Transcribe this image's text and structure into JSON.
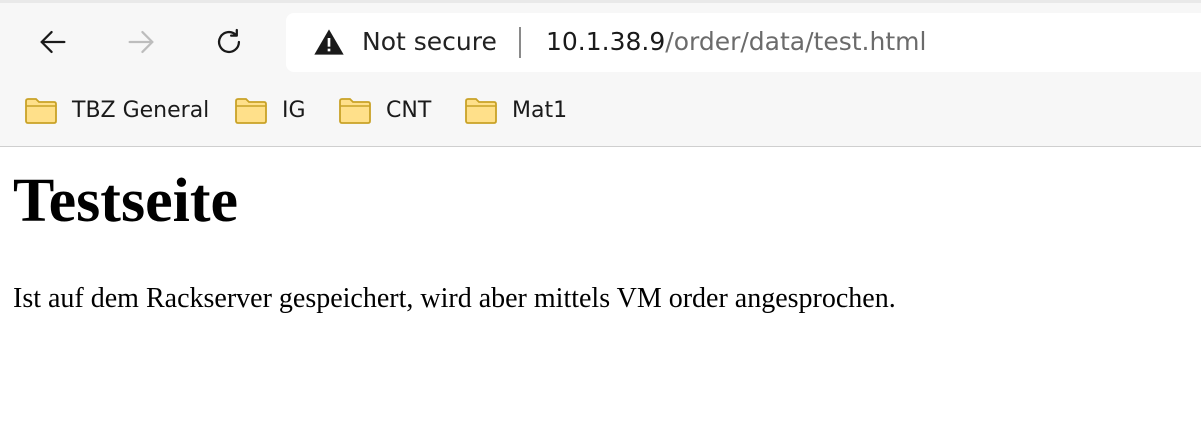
{
  "browser": {
    "nav": {
      "back_icon": "arrow-left-icon",
      "forward_icon": "arrow-right-icon",
      "reload_icon": "reload-icon"
    },
    "address_bar": {
      "security_icon": "warning-triangle-icon",
      "security_label": "Not secure",
      "url_host": "10.1.38.9",
      "url_path": "/order/data/test.html"
    },
    "bookmarks": [
      {
        "label": "TBZ General",
        "icon": "folder-icon"
      },
      {
        "label": "IG",
        "icon": "folder-icon"
      },
      {
        "label": "CNT",
        "icon": "folder-icon"
      },
      {
        "label": "Mat1",
        "icon": "folder-icon"
      }
    ],
    "colors": {
      "folder_fill": "#ffe08a",
      "folder_stroke": "#c9a227",
      "toolbar_bg": "#f7f7f7"
    }
  },
  "page": {
    "heading": "Testseite",
    "paragraph": "Ist auf dem Rackserver gespeichert, wird aber mittels VM order angesprochen."
  }
}
